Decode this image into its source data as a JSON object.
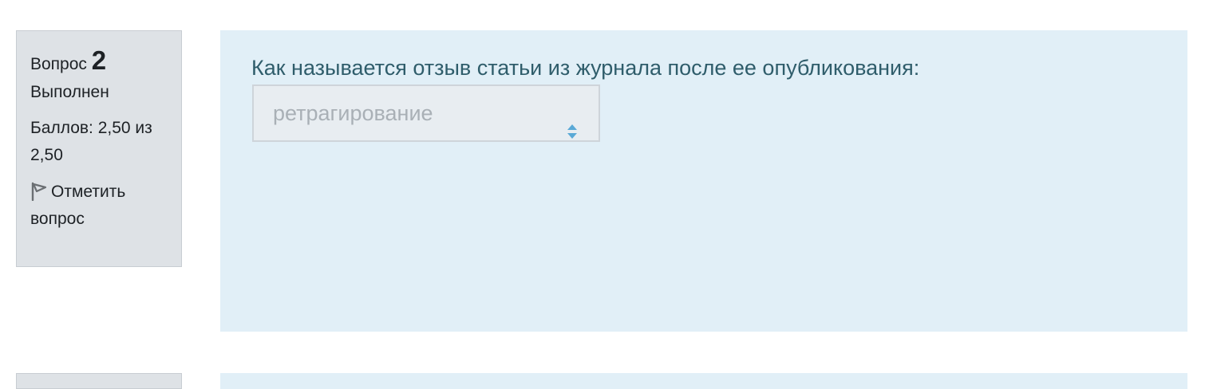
{
  "question": {
    "word": "Вопрос",
    "number": "2",
    "state": "Выполнен",
    "grade": "Баллов: 2,50 из 2,50",
    "flag_label": "Отметить вопрос",
    "flag_icon": "flag-icon",
    "text": "Как называется отзыв статьи из журнала после ее опубликования:",
    "select_value": "ретрагирование",
    "select_icon": "select-arrows-icon"
  },
  "colors": {
    "info_bg": "#dee2e6",
    "content_bg": "#e1eff7",
    "question_text": "#2f5d6b",
    "select_arrow": "#5aa9d6"
  }
}
